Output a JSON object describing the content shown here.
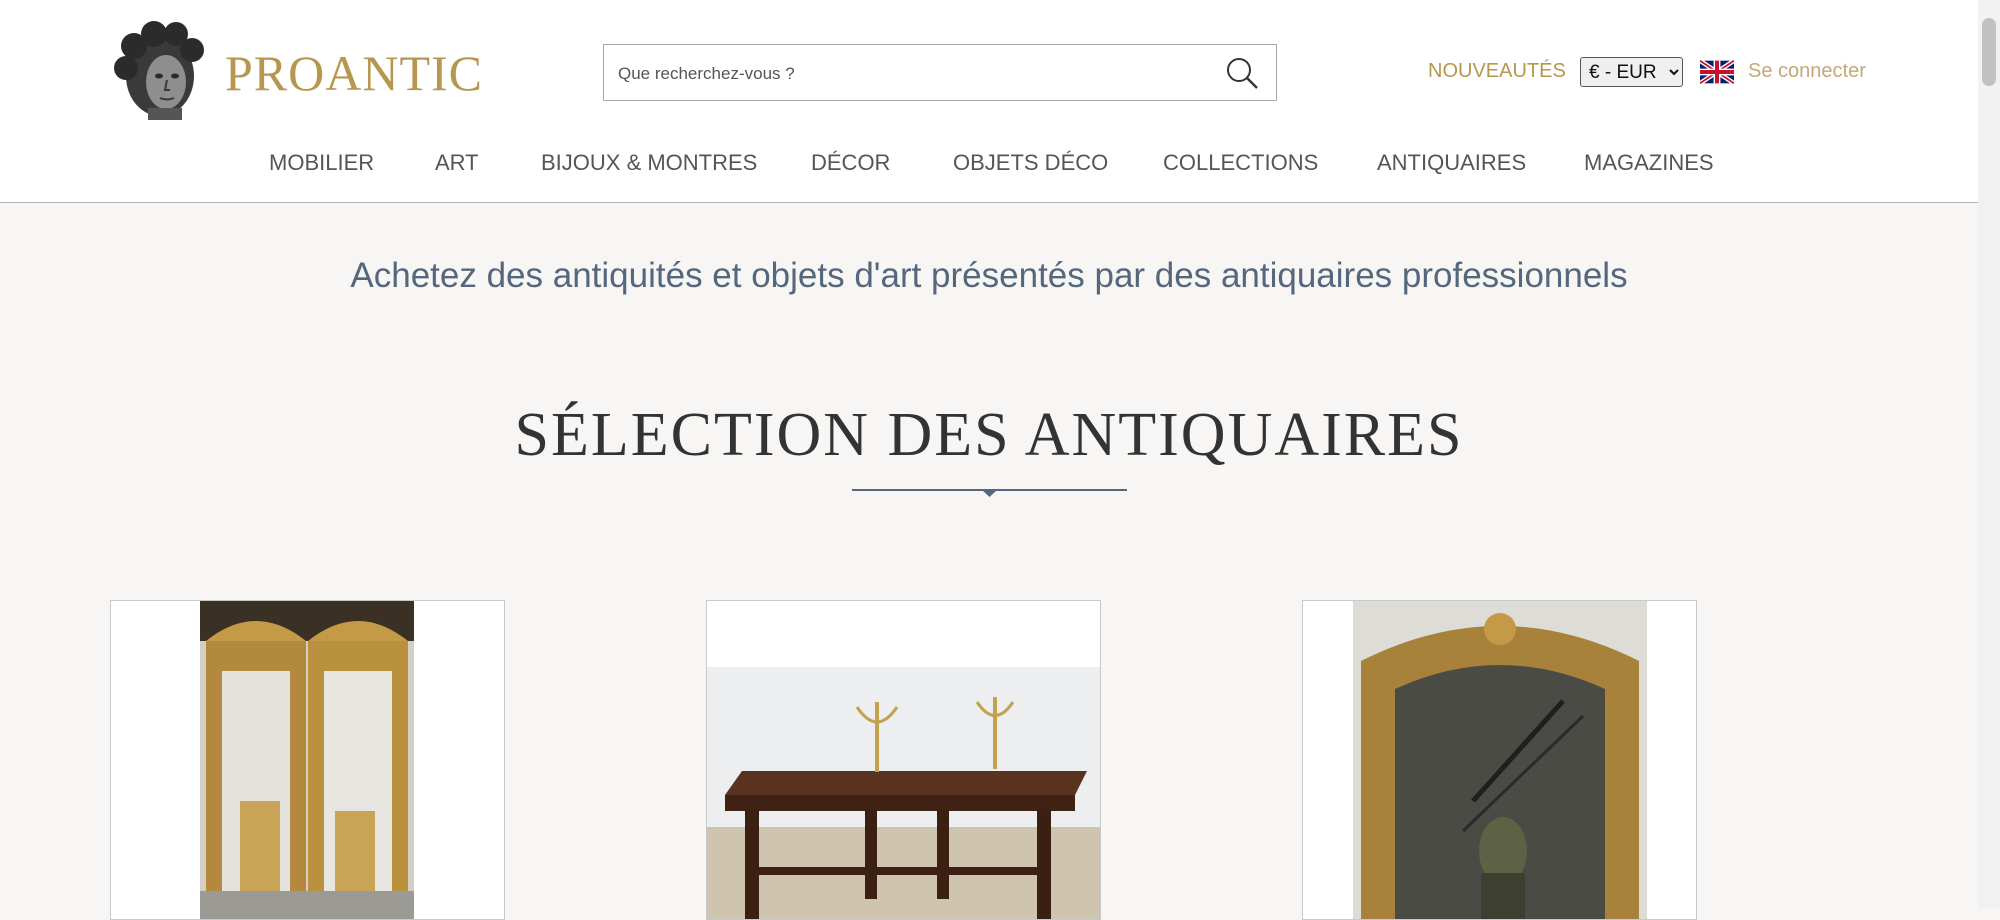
{
  "header": {
    "brand": "PROANTIC",
    "search_placeholder": "Que recherchez-vous ?",
    "nouveautes": "NOUVEAUTÉS",
    "currency_selected": "€ - EUR",
    "login": "Se connecter"
  },
  "nav": [
    "MOBILIER",
    "ART",
    "BIJOUX & MONTRES",
    "DÉCOR",
    "OBJETS DÉCO",
    "COLLECTIONS",
    "ANTIQUAIRES",
    "MAGAZINES"
  ],
  "main": {
    "tagline": "Achetez des antiquités et objets d'art présentés par des antiquaires professionnels",
    "section_title": "SÉLECTION DES ANTIQUAIRES"
  },
  "products": [
    {
      "image": "gilded-mirrors-photo"
    },
    {
      "image": "oak-table-candelabra-photo"
    },
    {
      "image": "gilded-mirror-photo"
    }
  ],
  "colors": {
    "gold": "#b7964f",
    "login": "#c4a878",
    "slate": "#55677d"
  }
}
